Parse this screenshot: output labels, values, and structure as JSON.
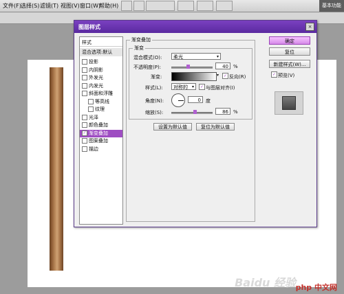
{
  "app": {
    "menu": [
      "文件(F)",
      "选择(S)",
      "滤镜(T)",
      "视图(V)",
      "窗口(W)",
      "帮助(H)"
    ],
    "workspace": "基本功能"
  },
  "dialog": {
    "title": "图层样式",
    "close_glyph": "×"
  },
  "styles_list": {
    "header": "样式",
    "blend_options": "混合选项:默认",
    "items": [
      {
        "label": "投影",
        "checked": false,
        "sub": false,
        "selected": false
      },
      {
        "label": "内阴影",
        "checked": false,
        "sub": false,
        "selected": false
      },
      {
        "label": "外发光",
        "checked": false,
        "sub": false,
        "selected": false
      },
      {
        "label": "内发光",
        "checked": false,
        "sub": false,
        "selected": false
      },
      {
        "label": "斜面和浮雕",
        "checked": false,
        "sub": false,
        "selected": false
      },
      {
        "label": "等高线",
        "checked": false,
        "sub": true,
        "selected": false
      },
      {
        "label": "纹理",
        "checked": false,
        "sub": true,
        "selected": false
      },
      {
        "label": "光泽",
        "checked": false,
        "sub": false,
        "selected": false
      },
      {
        "label": "颜色叠加",
        "checked": false,
        "sub": false,
        "selected": false
      },
      {
        "label": "渐变叠加",
        "checked": true,
        "sub": false,
        "selected": true
      },
      {
        "label": "图案叠加",
        "checked": false,
        "sub": false,
        "selected": false
      },
      {
        "label": "描边",
        "checked": false,
        "sub": false,
        "selected": false
      }
    ],
    "check_glyph": "✓"
  },
  "panel": {
    "group_title": "渐变叠加",
    "sub_group_title": "渐变",
    "blend_mode_label": "混合模式(O):",
    "blend_mode_value": "柔光",
    "opacity_label": "不透明度(P):",
    "opacity_value": "40",
    "opacity_level": 40,
    "percent": "%",
    "gradient_label": "渐变:",
    "reverse_label": "反向(R)",
    "reverse_checked": true,
    "style_label": "样式(L):",
    "style_value": "对称的",
    "align_label": "与图层对齐(I)",
    "align_checked": true,
    "angle_label": "角度(N):",
    "angle_value": "0",
    "degree": "度",
    "scale_label": "缩放(S):",
    "scale_value": "86",
    "scale_level": 86,
    "default_btn": "设置为默认值",
    "reset_btn": "复位为默认值",
    "arrow_glyph": "▾"
  },
  "buttons": {
    "ok": "确定",
    "reset": "复位",
    "new_style": "新建样式(W)...",
    "preview_label": "预览(V)",
    "preview_checked": true
  },
  "watermark": {
    "baidu": "Baidu 经验",
    "brand": "php 中文网"
  },
  "colors": {
    "accent": "#9e4dc2",
    "title_bar": "#6a35b0",
    "default_button": "#e0a0f0"
  }
}
